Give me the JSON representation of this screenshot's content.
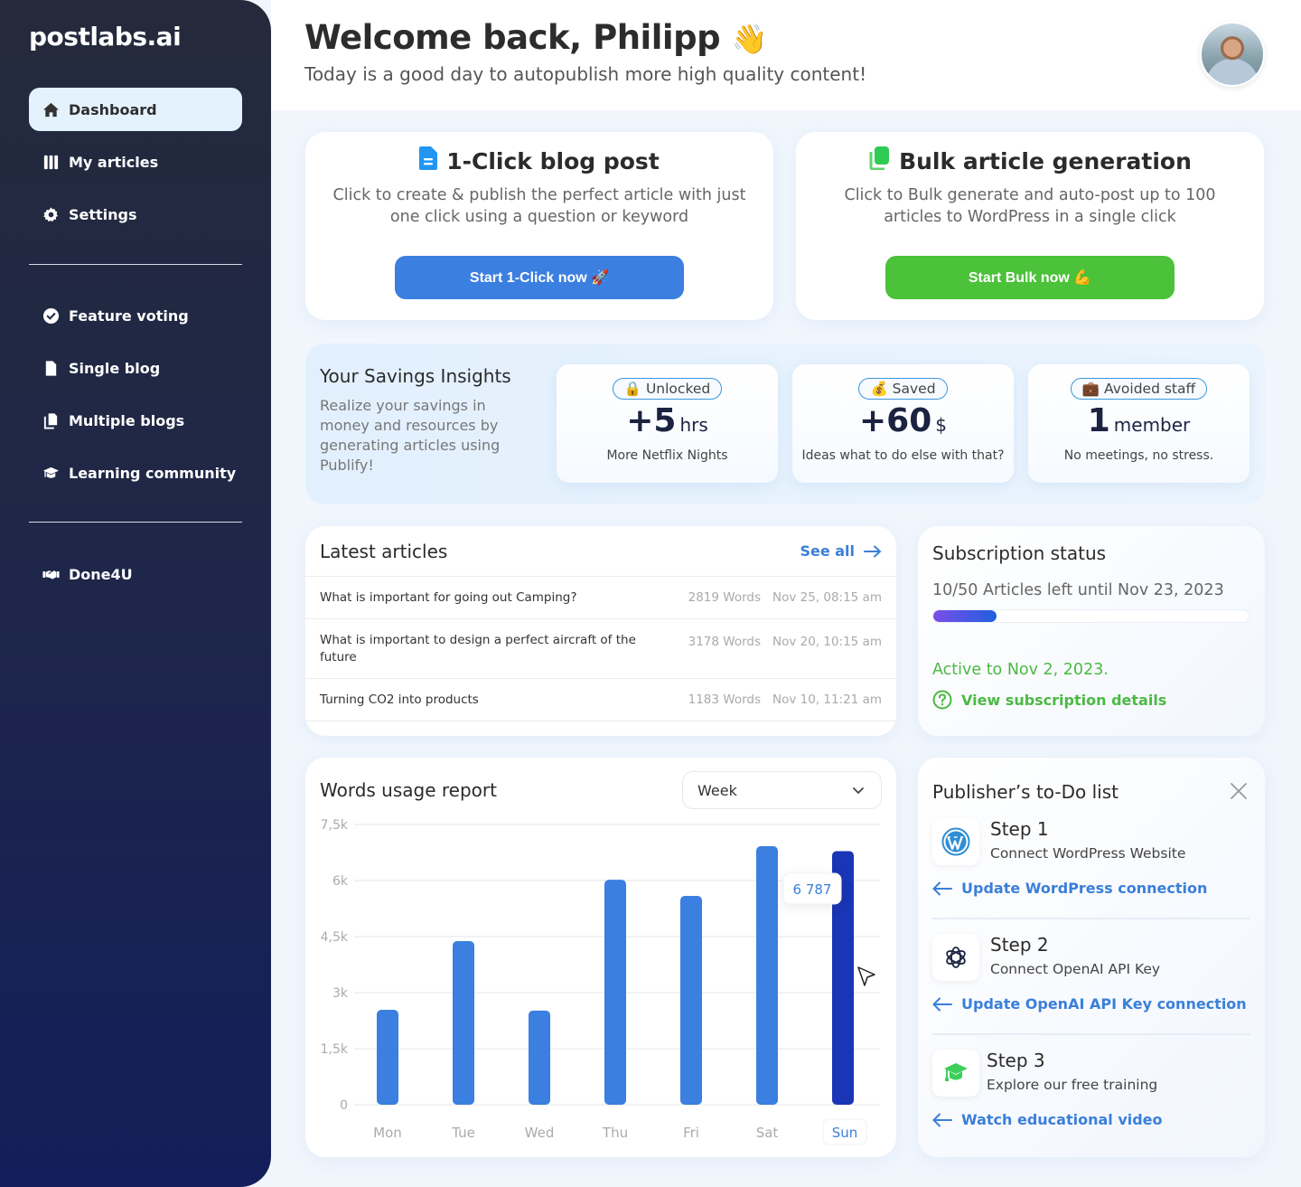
{
  "brand": {
    "logo": "postlabs.ai"
  },
  "sidebar": {
    "items": [
      {
        "label": "Dashboard",
        "icon": "home-icon",
        "active": true
      },
      {
        "label": "My articles",
        "icon": "columns-icon"
      },
      {
        "label": "Settings",
        "icon": "gear-icon"
      },
      {
        "label": "Feature voting",
        "icon": "check-badge-icon"
      },
      {
        "label": "Single blog",
        "icon": "document-icon"
      },
      {
        "label": "Multiple blogs",
        "icon": "documents-icon"
      },
      {
        "label": "Learning community",
        "icon": "graduation-cap-icon"
      },
      {
        "label": "Done4U",
        "icon": "handshake-icon"
      }
    ]
  },
  "header": {
    "welcome": "Welcome back, Philipp",
    "wave_emoji": "👋",
    "subtitle": "Today is a good day to autopublish more high quality content!"
  },
  "actions": {
    "one_click": {
      "title": "1-Click blog post",
      "description": "Click to create & publish the perfect article with just one click using a question or keyword",
      "button": "Start 1-Click now 🚀",
      "color": "#3b7fe0"
    },
    "bulk": {
      "title": "Bulk article generation",
      "description": "Click to Bulk generate and auto-post up to 100 articles to WordPress in a single click",
      "button": "Start Bulk now 💪",
      "color": "#4cc13a"
    }
  },
  "savings": {
    "title": "Your Savings Insights",
    "description": "Realize your savings in money and resources by generating articles using Publify!",
    "stats": [
      {
        "badge": "🔒 Unlocked",
        "value": "+5",
        "unit": "hrs",
        "note": "More Netflix Nights"
      },
      {
        "badge": "💰 Saved",
        "value": "+60",
        "unit": "$",
        "note": "Ideas what to do else with that?"
      },
      {
        "badge": "💼 Avoided staff",
        "value": "1",
        "unit": "member",
        "note": "No meetings, no stress."
      }
    ]
  },
  "articles": {
    "title": "Latest articles",
    "see_all": "See all",
    "rows": [
      {
        "title": "What is important for going out Camping?",
        "words": "2819 Words",
        "date": "Nov 25, 08:15 am"
      },
      {
        "title": "What is important to design a perfect aircraft of the future",
        "words": "3178 Words",
        "date": "Nov 20, 10:15 am"
      },
      {
        "title": "Turning CO2 into products",
        "words": "1183 Words",
        "date": "Nov 10, 11:21 am"
      }
    ]
  },
  "subscription": {
    "title": "Subscription status",
    "articles_left": "10/50 Articles left until Nov 23, 2023",
    "progress_fraction": 0.2,
    "active_until": "Active to Nov 2, 2023.",
    "details_link": "View subscription details"
  },
  "words_usage": {
    "title": "Words usage report",
    "period": "Week"
  },
  "chart_data": {
    "type": "bar",
    "title": "Words usage report",
    "categories": [
      "Mon",
      "Tue",
      "Wed",
      "Thu",
      "Fri",
      "Sat",
      "Sun"
    ],
    "values": [
      2540,
      4380,
      2520,
      6020,
      5590,
      6920,
      6787
    ],
    "ylim": [
      0,
      7500
    ],
    "yticks": [
      0,
      1500,
      3000,
      4500,
      6000,
      7500
    ],
    "ytick_labels": [
      "0",
      "1,5k",
      "3k",
      "4,5k",
      "6k",
      "7,5k"
    ],
    "highlighted": "Sun",
    "tooltip": "6 787",
    "bar_color": "#3b7fe0",
    "highlight_color": "#1a35b5",
    "grid": true,
    "xlabel": "",
    "ylabel": ""
  },
  "todo": {
    "title": "Publisher’s to-Do list",
    "steps": [
      {
        "name": "Step 1",
        "desc": "Connect WordPress Website",
        "link": "Update WordPress connection",
        "icon": "wordpress-icon"
      },
      {
        "name": "Step 2",
        "desc": "Connect OpenAI API Key",
        "link": "Update OpenAI API Key connection",
        "icon": "openai-icon"
      },
      {
        "name": "Step 3",
        "desc": "Explore our free training",
        "link": "Watch educational video",
        "icon": "graduation-cap-icon"
      }
    ]
  }
}
